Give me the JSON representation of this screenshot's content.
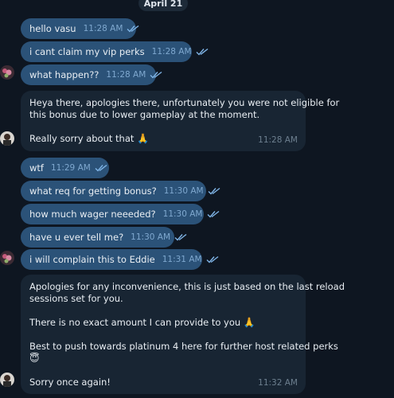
{
  "date_label": "April 21",
  "messages": [
    {
      "text": "hello vasu",
      "time": "11:28 AM"
    },
    {
      "text": "i cant claim my vip perks",
      "time": "11:28 AM"
    },
    {
      "text": "what happen??",
      "time": "11:28 AM"
    },
    {
      "lines": [
        "Heya there, apologies there, unfortunately you were not eligible for",
        "this bonus due to lower gameplay at the moment.",
        "",
        "Really sorry about that"
      ],
      "emoji": "🙏",
      "time": "11:28 AM"
    },
    {
      "text": "wtf",
      "time": "11:29 AM"
    },
    {
      "text": "what req for getting bonus?",
      "time": "11:30 AM"
    },
    {
      "text": "how much wager neeeded?",
      "time": "11:30 AM"
    },
    {
      "text": "have u ever tell me?",
      "time": "11:30 AM"
    },
    {
      "text": "i will complain this to Eddie",
      "time": "11:31 AM"
    },
    {
      "lines": [
        "Apologies for any inconvenience, this is just based on the last reload",
        "sessions set for you.",
        "",
        "There is no exact amount I can provide to you",
        "",
        "Best to push towards platinum 4 here for further host related perks",
        "",
        "",
        "Sorry once again!"
      ],
      "emoji_line4": "🙏",
      "emoji_line7": "😇",
      "time": "11:32 AM"
    }
  ],
  "colors": {
    "background": "#0e1621",
    "outgoing_bubble": "#2b5278",
    "incoming_bubble": "#182533",
    "tick": "#7fb4e6"
  },
  "icons": [
    "double-check-icon",
    "avatar-icon",
    "folded-hands-emoji",
    "smiling-halo-emoji"
  ]
}
